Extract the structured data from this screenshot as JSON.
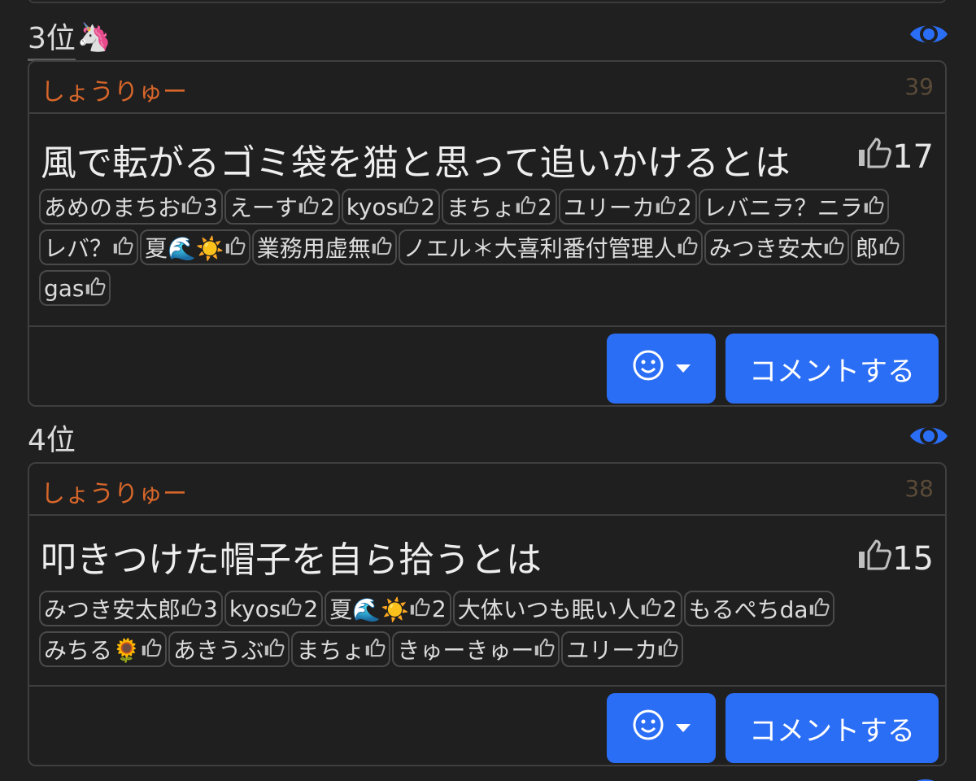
{
  "posts": [
    {
      "rank": "3位",
      "rank_emoji": "🦄",
      "author": "しょうりゅー",
      "score": "39",
      "title": "風で転がるゴミ袋を猫と思って追いかけるとは",
      "likes": "17",
      "reactions": [
        {
          "name": "あめのまちお",
          "count": "3"
        },
        {
          "name": "えーす",
          "count": "2"
        },
        {
          "name": "kyos",
          "count": "2"
        },
        {
          "name": "まちょ",
          "count": "2"
        },
        {
          "name": "ユリーカ",
          "count": "2"
        },
        {
          "name": "レバニラ？ニラ",
          "count": ""
        },
        {
          "name": "レバ？",
          "count": ""
        },
        {
          "name": "夏🌊☀️",
          "count": ""
        },
        {
          "name": "業務用虚無",
          "count": ""
        },
        {
          "name": "ノエル＊大喜利番付管理人",
          "count": ""
        },
        {
          "name": "みつき安太",
          "count": ""
        },
        {
          "name": "郎",
          "count": ""
        },
        {
          "name": "gas",
          "count": ""
        }
      ],
      "comment_label": "コメントする"
    },
    {
      "rank": "4位",
      "rank_emoji": "",
      "author": "しょうりゅー",
      "score": "38",
      "title": "叩きつけた帽子を自ら拾うとは",
      "likes": "15",
      "reactions": [
        {
          "name": "みつき安太郎",
          "count": "3"
        },
        {
          "name": "kyos",
          "count": "2"
        },
        {
          "name": "夏🌊☀️",
          "count": "2"
        },
        {
          "name": "大体いつも眠い人",
          "count": "2"
        },
        {
          "name": "もるぺちda",
          "count": ""
        },
        {
          "name": "みちる🌻",
          "count": ""
        },
        {
          "name": "あきうぶ",
          "count": ""
        },
        {
          "name": "まちょ",
          "count": ""
        },
        {
          "name": "きゅーきゅー",
          "count": ""
        },
        {
          "name": "ユリーカ",
          "count": ""
        }
      ],
      "comment_label": "コメントする"
    }
  ],
  "colors": {
    "background": "#202020",
    "author": "#d7662a",
    "score": "#5a4a38",
    "button": "#2b6ef6",
    "eye": "#2b6ef6"
  },
  "icons": {
    "thumb": "thumbs-up-icon",
    "eye": "eye-icon",
    "smile": "smiley-icon",
    "caret": "caret-down-icon"
  }
}
